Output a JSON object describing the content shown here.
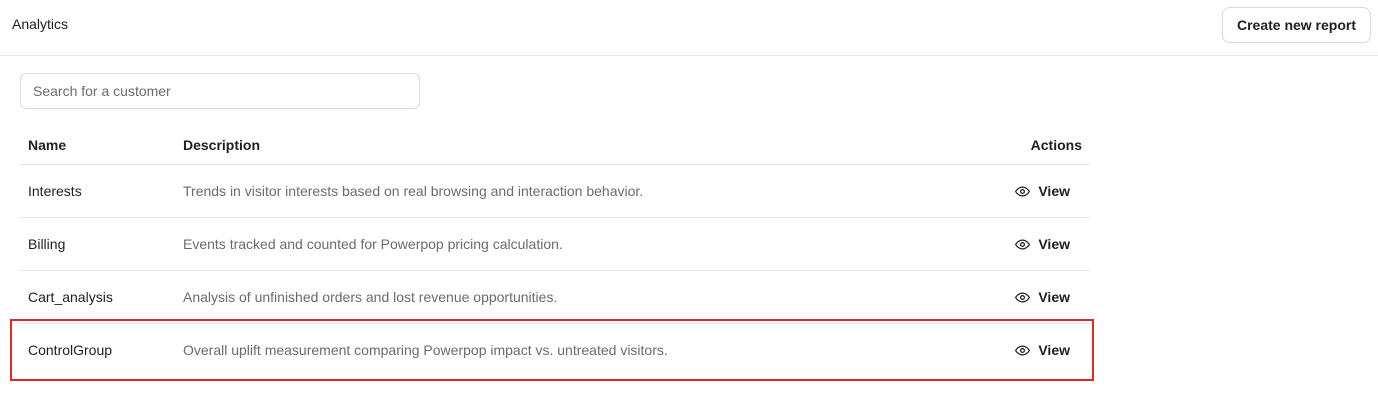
{
  "header": {
    "title": "Analytics",
    "create_button_label": "Create new report"
  },
  "search": {
    "placeholder": "Search for a customer",
    "value": ""
  },
  "table": {
    "columns": {
      "name": "Name",
      "description": "Description",
      "actions": "Actions"
    },
    "rows": [
      {
        "name": "Interests",
        "description": "Trends in visitor interests based on real browsing and interaction behavior.",
        "action_label": "View",
        "action_icon": "eye-icon"
      },
      {
        "name": "Billing",
        "description": "Events tracked and counted for Powerpop pricing calculation.",
        "action_label": "View",
        "action_icon": "eye-icon"
      },
      {
        "name": "Cart_analysis",
        "description": "Analysis of unfinished orders and lost revenue opportunities.",
        "action_label": "View",
        "action_icon": "eye-icon"
      },
      {
        "name": "ControlGroup",
        "description": "Overall uplift measurement comparing Powerpop impact vs. untreated visitors.",
        "action_label": "View",
        "action_icon": "eye-icon"
      }
    ]
  },
  "highlight": {
    "color": "#d92b2b",
    "target_row": 3
  }
}
